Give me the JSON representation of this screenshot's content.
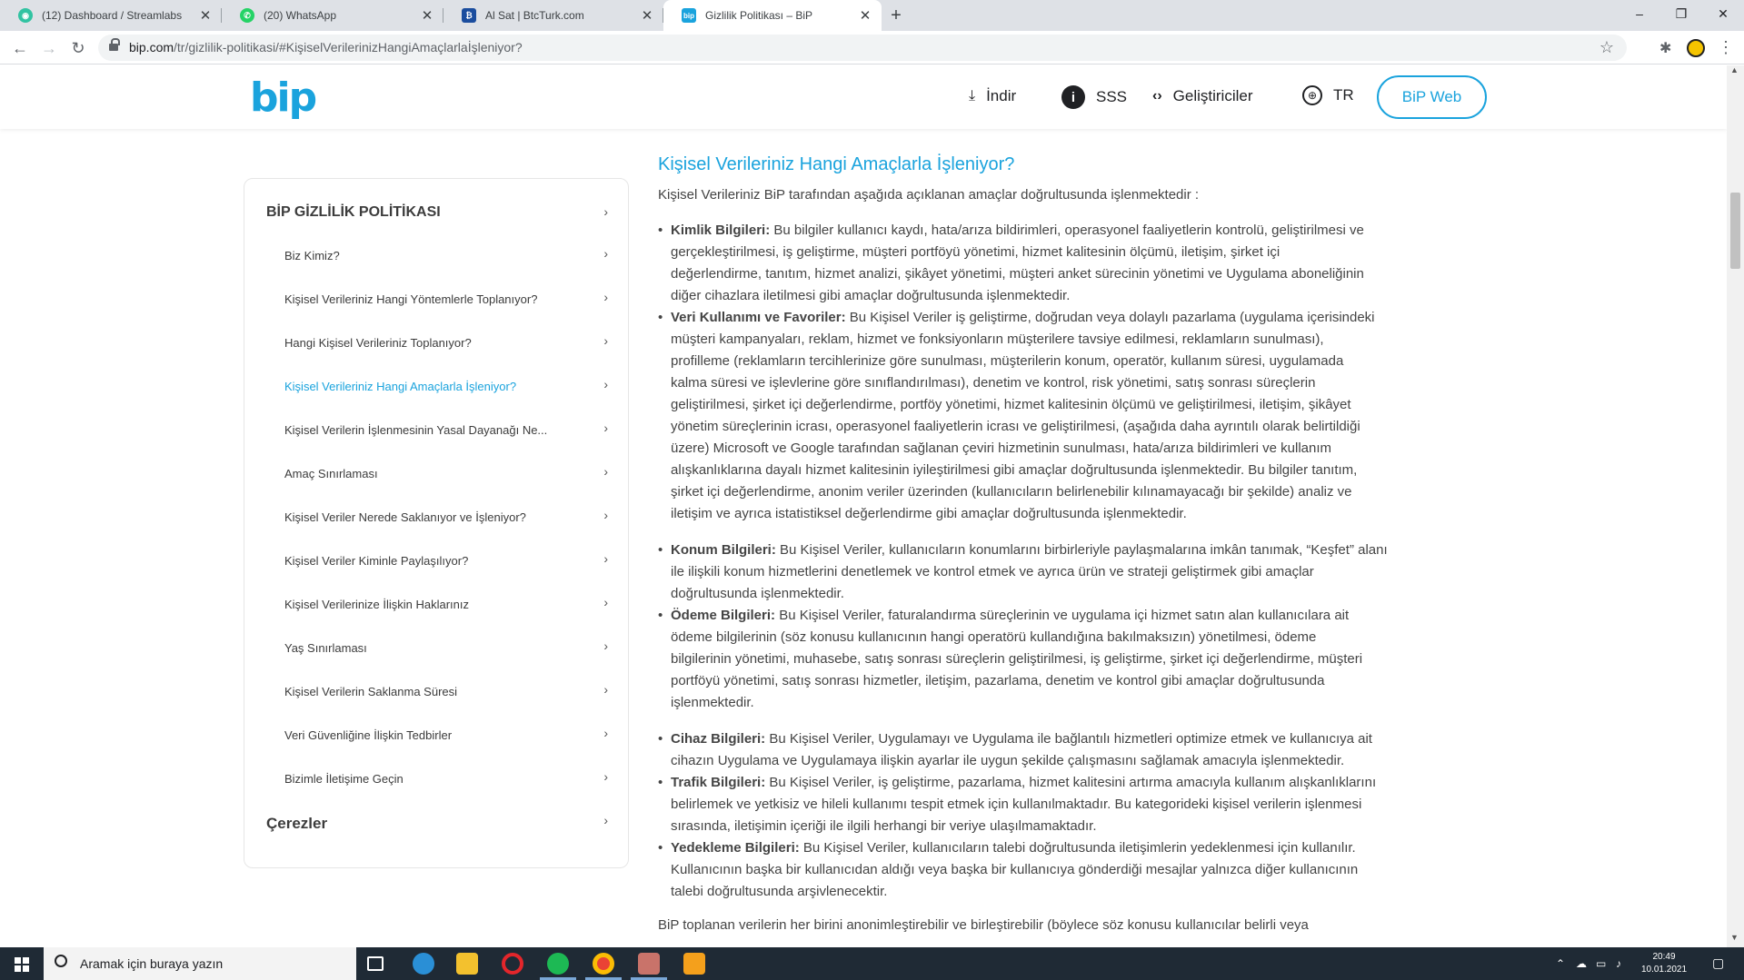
{
  "browser": {
    "tabs": [
      {
        "title": "(12) Dashboard / Streamlabs",
        "favicon": "streamlabs-icon",
        "color": "#31c3a2",
        "active": false
      },
      {
        "title": "(20) WhatsApp",
        "favicon": "whatsapp-icon",
        "color": "#25d366",
        "active": false
      },
      {
        "title": "Al Sat | BtcTurk.com",
        "favicon": "btcturk-icon",
        "color": "#1b4d9e",
        "active": false
      },
      {
        "title": "Gizlilik Politikası – BiP",
        "favicon": "bip-icon",
        "color": "#1aa3dd",
        "active": true
      }
    ],
    "new_tab": "+",
    "window_controls": {
      "minimize": "–",
      "maximize": "❐",
      "close": "✕"
    },
    "nav": {
      "back": "←",
      "forward": "→",
      "reload": "↻"
    },
    "url_host": "bip.com",
    "url_path": "/tr/gizlilik-politikasi/#KişiselVerilerinizHangiAmaçlarlaİşleniyor?"
  },
  "site_header": {
    "logo": "bip",
    "nav": [
      {
        "label": "İndir",
        "icon": "download-icon"
      },
      {
        "label": "SSS",
        "icon": "info-icon"
      },
      {
        "label": "Geliştiriciler",
        "icon": "code-icon"
      },
      {
        "label": "TR",
        "icon": "globe-icon"
      }
    ],
    "web_button": "BiP Web"
  },
  "sidebar": {
    "heading": "BİP GİZLİLİK POLİTİKASI",
    "items": [
      {
        "label": "Biz Kimiz?",
        "active": false
      },
      {
        "label": "Kişisel Verileriniz Hangi Yöntemlerle Toplanıyor?",
        "active": false
      },
      {
        "label": "Hangi Kişisel Verileriniz Toplanıyor?",
        "active": false
      },
      {
        "label": "Kişisel Verileriniz Hangi Amaçlarla İşleniyor?",
        "active": true
      },
      {
        "label": "Kişisel Verilerin İşlenmesinin Yasal Dayanağı Ne...",
        "active": false
      },
      {
        "label": "Amaç Sınırlaması",
        "active": false
      },
      {
        "label": "Kişisel Veriler Nerede Saklanıyor ve İşleniyor?",
        "active": false
      },
      {
        "label": "Kişisel Veriler Kiminle Paylaşılıyor?",
        "active": false
      },
      {
        "label": "Kişisel Verilerinize İlişkin Haklarınız",
        "active": false
      },
      {
        "label": "Yaş Sınırlaması",
        "active": false
      },
      {
        "label": "Kişisel Verilerin Saklanma Süresi",
        "active": false
      },
      {
        "label": "Veri Güvenliğine İlişkin Tedbirler",
        "active": false
      },
      {
        "label": "Bizimle İletişime Geçin",
        "active": false
      }
    ],
    "footer_heading": "Çerezler"
  },
  "content": {
    "heading": "Kişisel Verileriniz Hangi Amaçlarla İşleniyor?",
    "intro": "Kişisel Verileriniz BiP tarafından aşağıda açıklanan amaçlar doğrultusunda işlenmektedir :",
    "sections": [
      {
        "term": "Kimlik Bilgileri:",
        "lines": [
          "Bu bilgiler kullanıcı kaydı, hata/arıza bildirimleri, operasyonel faaliyetlerin kontrolü, geliştirilmesi ve",
          "gerçekleştirilmesi, iş geliştirme, müşteri portföyü yönetimi, hizmet kalitesinin ölçümü, iletişim, şirket içi",
          "değerlendirme, tanıtım, hizmet analizi, şikâyet yönetimi, müşteri anket sürecinin yönetimi ve Uygulama aboneliğinin",
          "diğer cihazlara iletilmesi gibi amaçlar doğrultusunda işlenmektedir."
        ]
      },
      {
        "term": "Veri Kullanımı ve Favoriler:",
        "lines": [
          "Bu Kişisel Veriler iş geliştirme, doğrudan veya dolaylı pazarlama (uygulama içerisindeki",
          "müşteri kampanyaları, reklam, hizmet ve fonksiyonların müşterilere tavsiye edilmesi, reklamların sunulması),",
          "profilleme (reklamların tercihlerinize göre sunulması, müşterilerin konum, operatör, kullanım süresi, uygulamada",
          "kalma süresi ve işlevlerine göre sınıflandırılması), denetim ve kontrol, risk yönetimi, satış sonrası süreçlerin",
          "geliştirilmesi, şirket içi değerlendirme, portföy yönetimi, hizmet kalitesinin ölçümü ve geliştirilmesi, iletişim, şikâyet",
          "yönetim süreçlerinin icrası, operasyonel faaliyetlerin icrası ve geliştirilmesi, (aşağıda daha ayrıntılı olarak belirtildiği",
          "üzere) Microsoft ve Google tarafından sağlanan çeviri hizmetinin sunulması, hata/arıza bildirimleri ve kullanım",
          "alışkanlıklarına dayalı hizmet kalitesinin iyileştirilmesi gibi amaçlar doğrultusunda işlenmektedir. Bu bilgiler tanıtım,",
          "şirket içi değerlendirme, anonim veriler üzerinden (kullanıcıların belirlenebilir kılınamayacağı bir şekilde)  analiz ve",
          "iletişim ve ayrıca istatistiksel değerlendirme gibi amaçlar doğrultusunda işlenmektedir."
        ]
      },
      {
        "term": "Konum Bilgileri:",
        "lines": [
          "Bu Kişisel Veriler, kullanıcıların konumlarını birbirleriyle paylaşmalarına imkân tanımak, “Keşfet” alanı",
          "ile ilişkili konum hizmetlerini denetlemek ve kontrol etmek ve ayrıca ürün ve strateji geliştirmek gibi amaçlar",
          "doğrultusunda işlenmektedir."
        ]
      },
      {
        "term": "Ödeme Bilgileri:",
        "lines": [
          "Bu Kişisel Veriler, faturalandırma süreçlerinin ve uygulama içi hizmet satın alan kullanıcılara ait",
          "ödeme bilgilerinin (söz konusu kullanıcının hangi operatörü kullandığına bakılmaksızın) yönetilmesi, ödeme",
          "bilgilerinin yönetimi, muhasebe, satış sonrası süreçlerin geliştirilmesi, iş geliştirme, şirket içi değerlendirme, müşteri",
          "portföyü yönetimi, satış sonrası hizmetler, iletişim, pazarlama, denetim ve kontrol gibi amaçlar doğrultusunda",
          "işlenmektedir."
        ]
      },
      {
        "term": "Cihaz Bilgileri:",
        "lines": [
          "Bu Kişisel Veriler, Uygulamayı ve Uygulama ile bağlantılı hizmetleri optimize etmek ve kullanıcıya ait",
          "cihazın Uygulama ve Uygulamaya ilişkin ayarlar ile uygun şekilde çalışmasını sağlamak amacıyla işlenmektedir."
        ]
      },
      {
        "term": "Trafik Bilgileri:",
        "lines": [
          "Bu Kişisel Veriler, iş geliştirme, pazarlama, hizmet kalitesini artırma amacıyla kullanım alışkanlıklarını",
          "belirlemek ve yetkisiz ve hileli kullanımı tespit etmek için kullanılmaktadır. Bu kategorideki kişisel verilerin işlenmesi",
          "sırasında, iletişimin içeriği ile ilgili herhangi bir veriye ulaşılmamaktadır."
        ]
      },
      {
        "term": "Yedekleme Bilgileri:",
        "lines": [
          "Bu Kişisel Veriler, kullanıcıların talebi doğrultusunda iletişimlerin yedeklenmesi için kullanılır.",
          "Kullanıcının başka bir kullanıcıdan aldığı veya başka bir kullanıcıya gönderdiği mesajlar yalnızca diğer kullanıcının",
          "talebi doğrultusunda arşivlenecektir."
        ]
      }
    ],
    "closing": "BiP toplanan verilerin her birini anonimleştirebilir ve birleştirebilir (böylece söz konusu kullanıcılar belirli veya"
  },
  "taskbar": {
    "search_placeholder": "Aramak için buraya yazın",
    "clock_time": "20:49",
    "clock_date": "10.01.2021",
    "apps": [
      "task-view-icon",
      "edge-icon",
      "file-explorer-icon",
      "opera-icon",
      "spotify-icon",
      "chrome-icon",
      "streamlabs-icon",
      "sublime-icon"
    ]
  },
  "colors": {
    "accent": "#1aa3dd",
    "taskbar": "#1f2a35"
  }
}
